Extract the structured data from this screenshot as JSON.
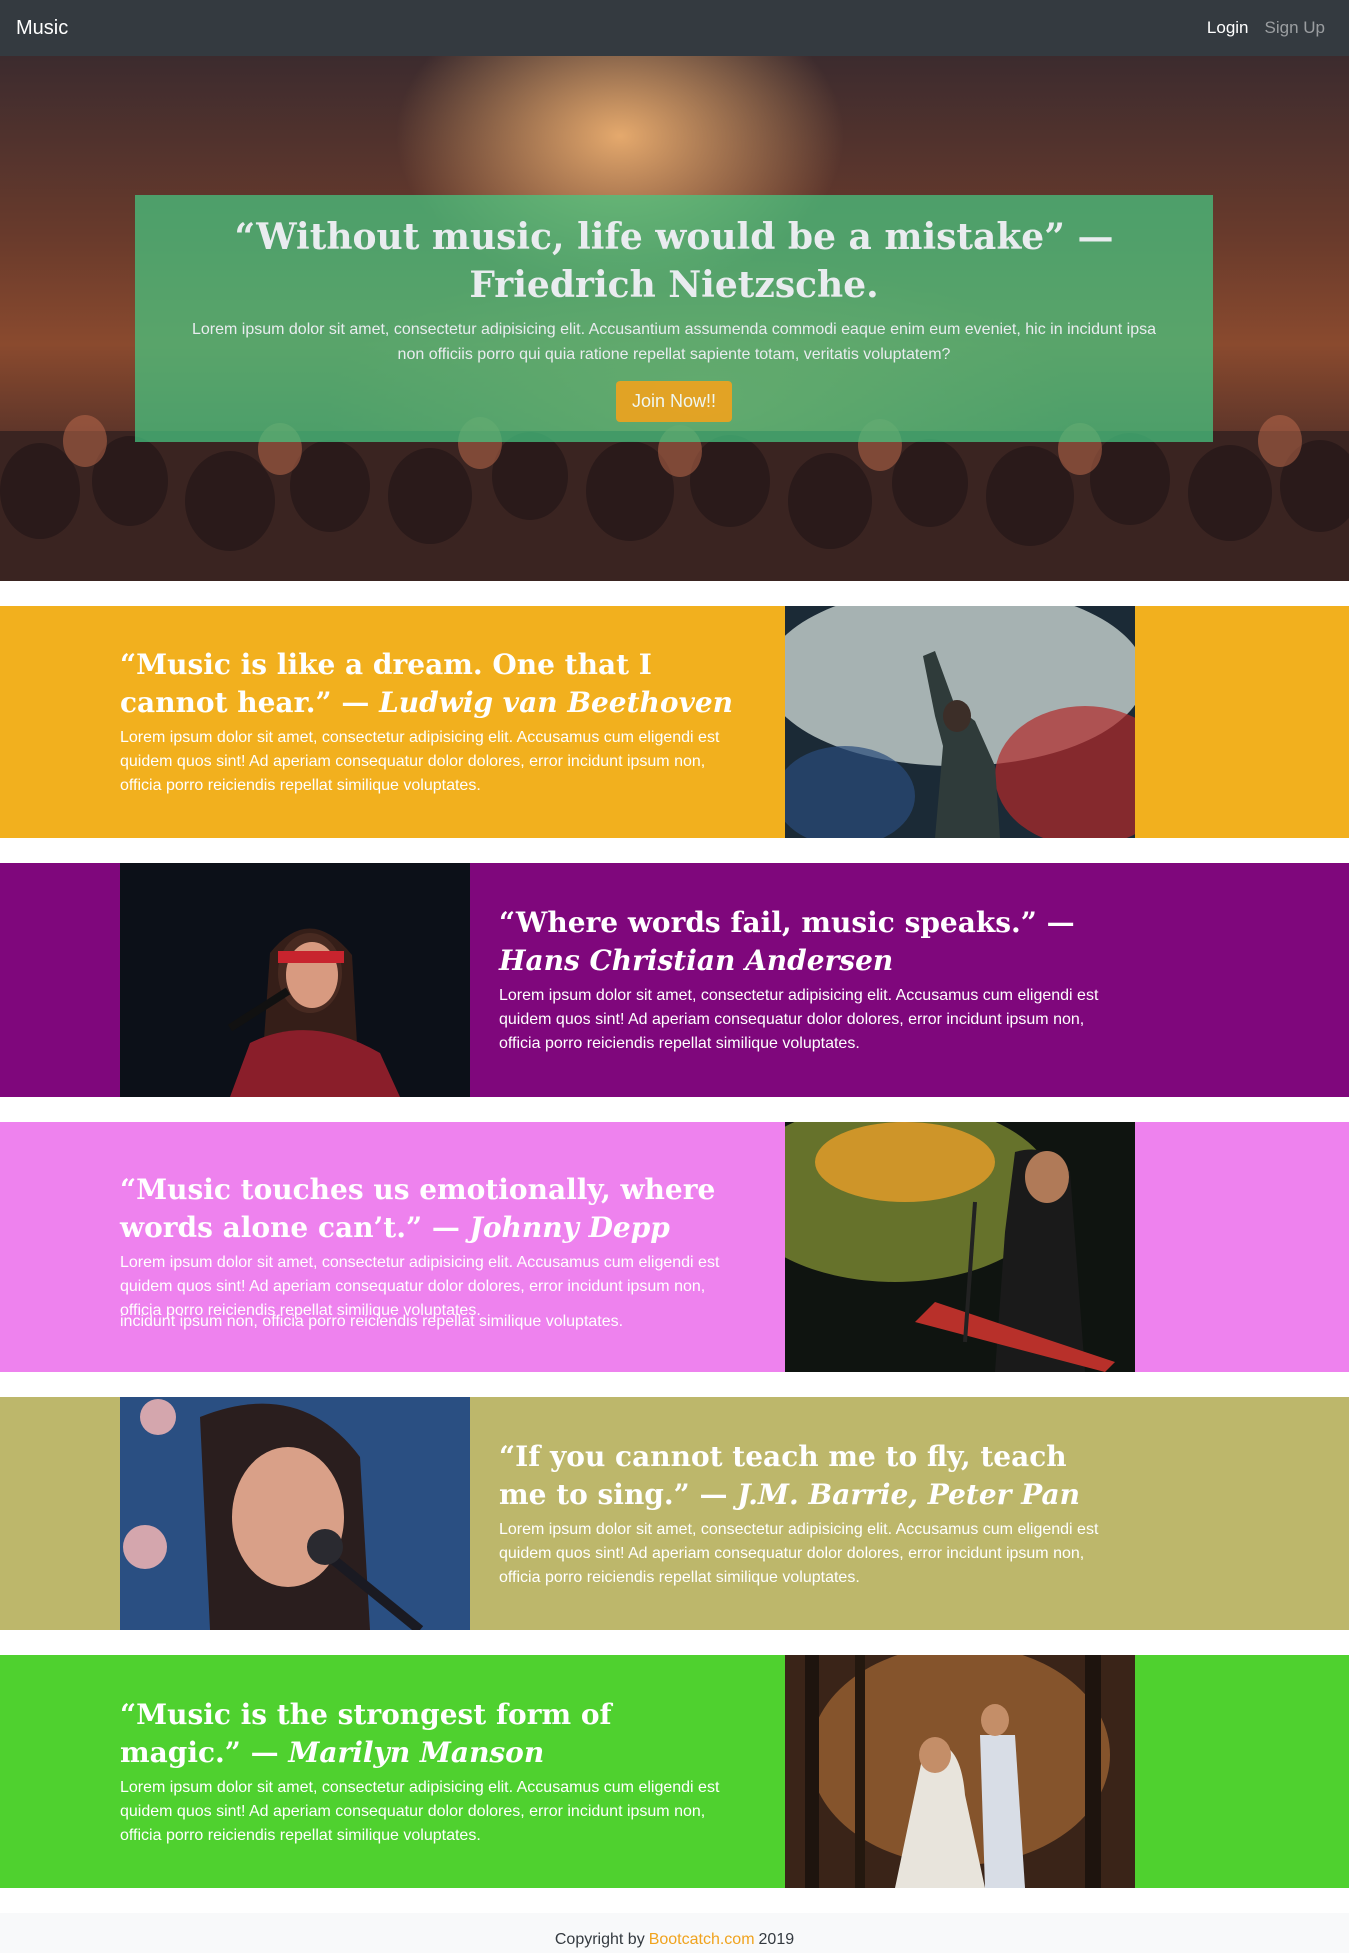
{
  "navbar": {
    "brand": "Music",
    "login": "Login",
    "signup": "Sign Up"
  },
  "hero": {
    "title": "“Without music, life would be a mistake” — Friedrich Nietzsche.",
    "text": "Lorem ipsum dolor sit amet, consectetur adipisicing elit. Accusantium assumenda commodi eaque enim eum eveniet, hic in incidunt ipsa non officiis porro qui quia ratione repellat sapiente totam, veritatis voluptatem?",
    "button": "Join Now!!"
  },
  "features": [
    {
      "quote": "“Music is like a dream. One that I cannot hear.” — ",
      "author": "Ludwig van Beethoven",
      "text": "Lorem ipsum dolor sit amet, consectetur adipisicing elit. Accusamus cum eligendi est quidem quos sint! Ad aperiam consequatur dolor dolores, error incidunt ipsum non, officia porro reiciendis repellat similique voluptates.",
      "image": "singer-on-stage-with-smoke",
      "color": "#f2b01e"
    },
    {
      "quote": "“Where words fail, music speaks.” — ",
      "author": "Hans Christian Andersen",
      "text": "Lorem ipsum dolor sit amet, consectetur adipisicing elit. Accusamus cum eligendi est quidem quos sint! Ad aperiam consequatur dolor dolores, error incidunt ipsum non, officia porro reiciendis repellat similique voluptates.",
      "image": "woman-singing-with-microphone",
      "color": "#7f077c"
    },
    {
      "quote": "“Music touches us emotionally, where words alone can’t.” — ",
      "author": "Johnny Depp",
      "text": "Lorem ipsum dolor sit amet, consectetur adipisicing elit. Accusamus cum eligendi est quidem quos sint! Ad aperiam consequatur dolor dolores, error incidunt ipsum non, officia porro reiciendis repellat similique voluptates.",
      "overflow": "incidunt ipsum non, officia porro reiciendis repellat similique voluptates.",
      "image": "keyboard-player-singing",
      "color": "#ee82ee"
    },
    {
      "quote": "“If you cannot teach me to fly, teach me to sing.” — ",
      "author": "J.M. Barrie, Peter Pan",
      "text": "Lorem ipsum dolor sit amet, consectetur adipisicing elit. Accusamus cum eligendi est quidem quos sint! Ad aperiam consequatur dolor dolores, error incidunt ipsum non, officia porro reiciendis repellat similique voluptates.",
      "image": "woman-singing-eyes-closed",
      "color": "#bdb76b"
    },
    {
      "quote": "“Music is the strongest form of magic.” — ",
      "author": "Marilyn Manson",
      "text": "Lorem ipsum dolor sit amet, consectetur adipisicing elit. Accusamus cum eligendi est quidem quos sint! Ad aperiam consequatur dolor dolores, error incidunt ipsum non, officia porro reiciendis repellat similique voluptates.",
      "image": "couple-dancing-in-forest",
      "color": "#4fd12f"
    }
  ],
  "footer": {
    "prefix": "Copyright by",
    "link": "Bootcatch.com",
    "year": "2019"
  }
}
